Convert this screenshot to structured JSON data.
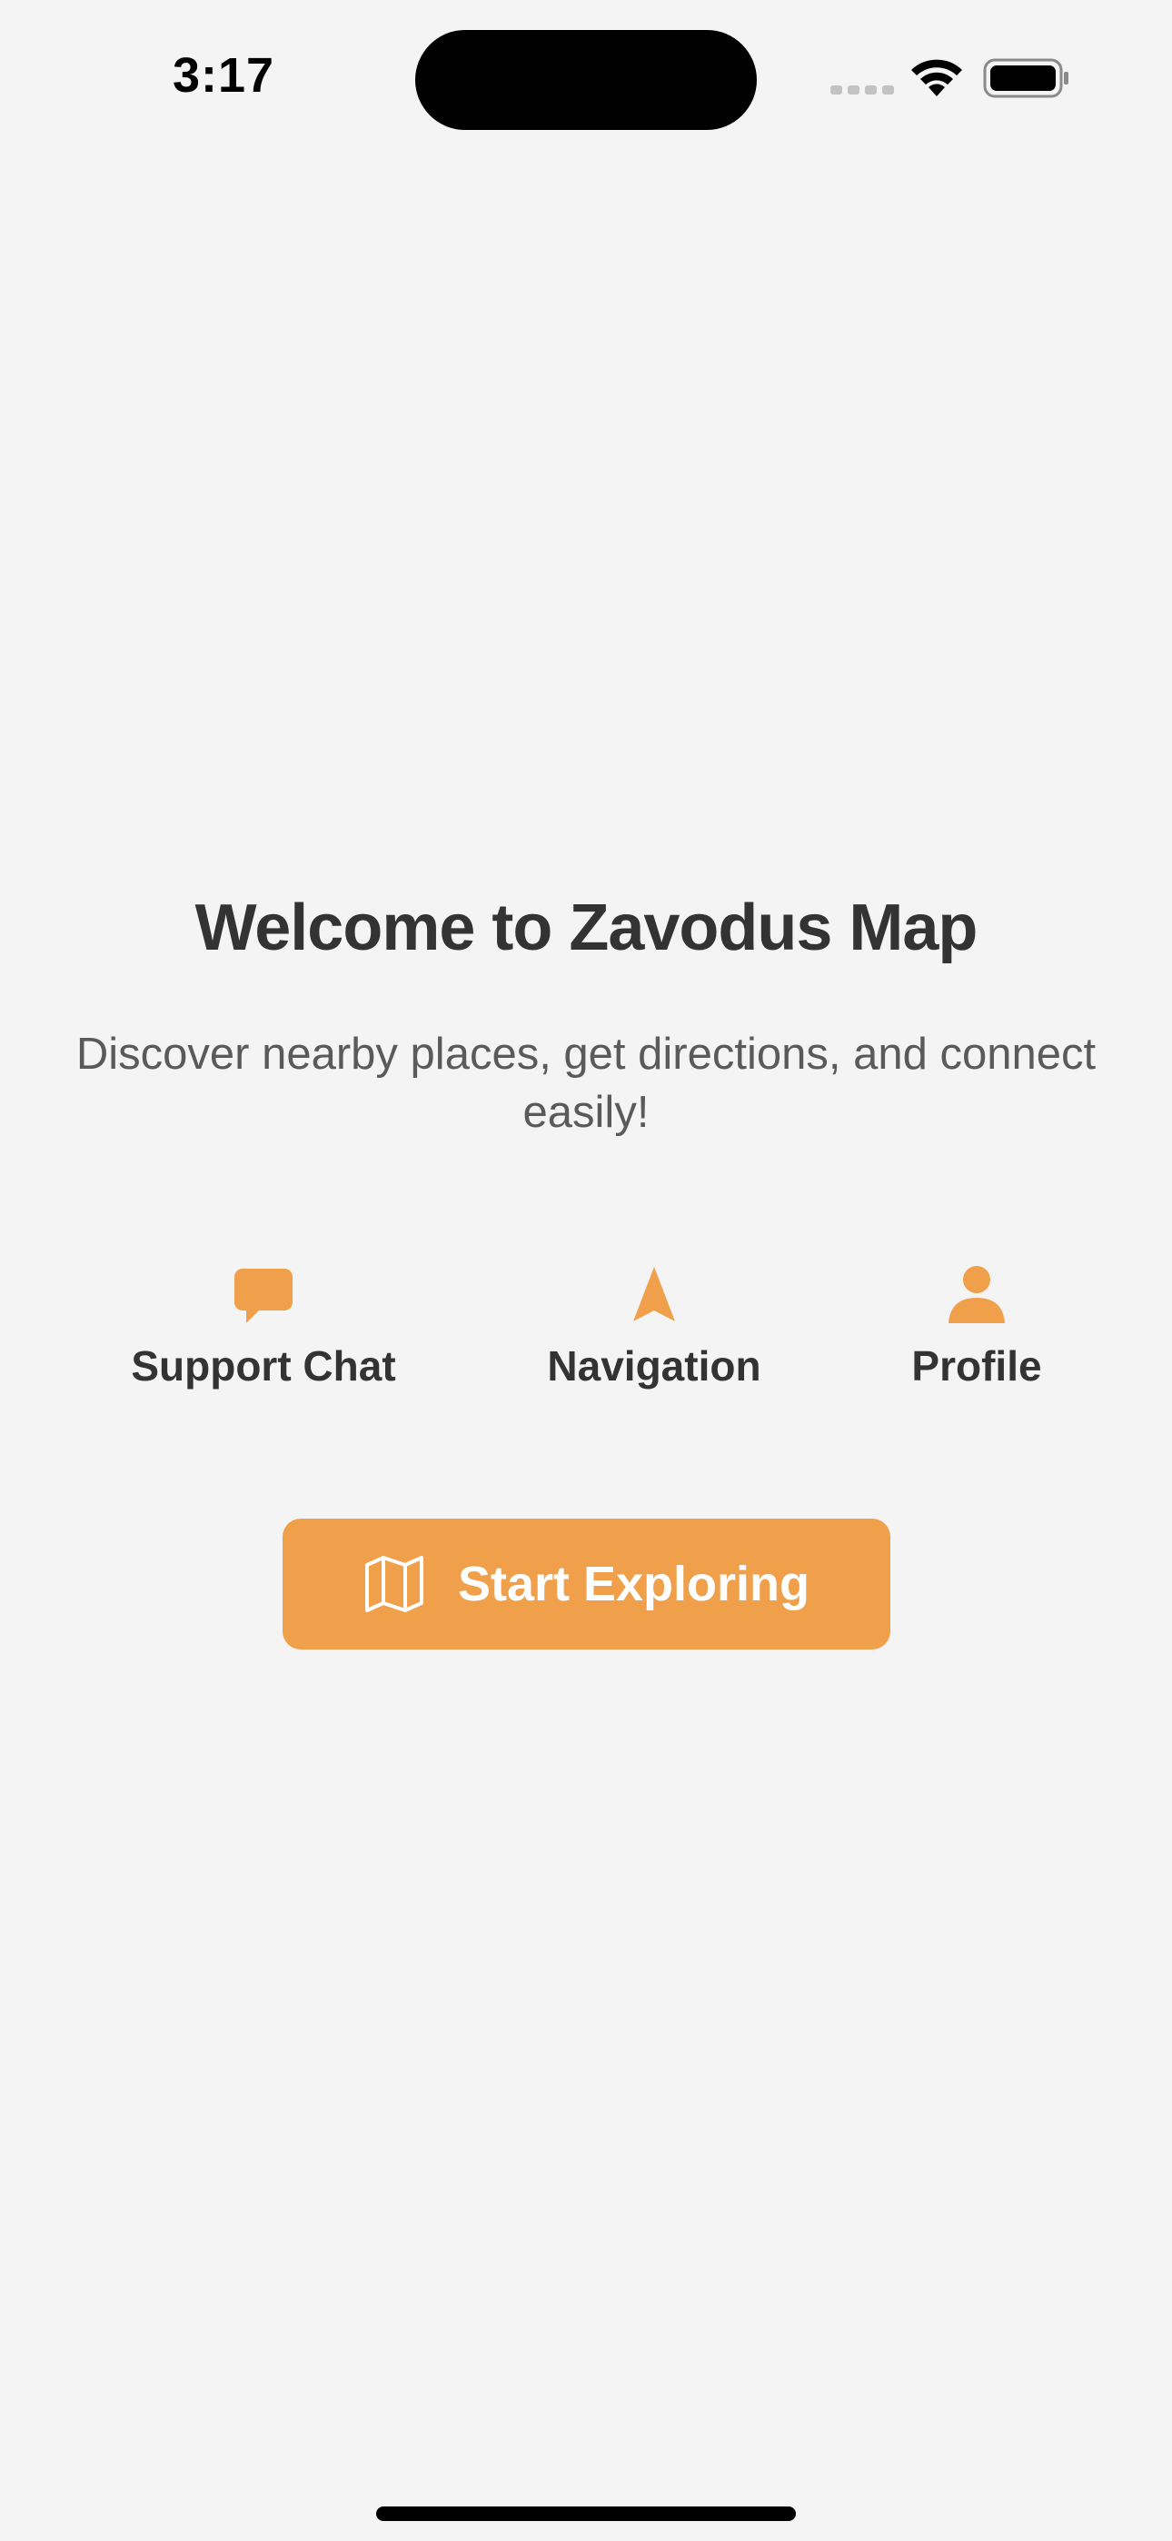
{
  "status_bar": {
    "time": "3:17",
    "icons": [
      "signal-icon",
      "wifi-icon",
      "battery-icon"
    ]
  },
  "main": {
    "title": "Welcome to Zavodus Map",
    "subtitle": "Discover nearby places, get directions, and connect easily!",
    "features": [
      {
        "label": "Support Chat",
        "icon": "chat-bubble-icon"
      },
      {
        "label": "Navigation",
        "icon": "navigation-arrow-icon"
      },
      {
        "label": "Profile",
        "icon": "person-icon"
      }
    ],
    "cta": {
      "label": "Start Exploring",
      "icon": "map-icon"
    }
  },
  "colors": {
    "accent": "#f0a04b",
    "background": "#f4f4f4",
    "title_text": "#333333",
    "subtitle_text": "#5a5a5a"
  }
}
